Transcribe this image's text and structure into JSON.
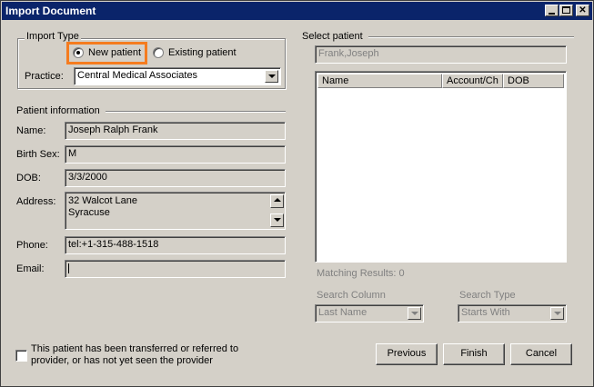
{
  "window": {
    "title": "Import Document"
  },
  "import_type": {
    "group_label": "Import Type",
    "new_patient_label": "New patient",
    "existing_patient_label": "Existing patient",
    "selected": "New patient",
    "practice_label": "Practice:",
    "practice_value": "Central Medical Associates"
  },
  "patient_info": {
    "section_label": "Patient information",
    "name_label": "Name:",
    "name_value": "Joseph Ralph Frank",
    "sex_label": "Birth Sex:",
    "sex_value": "M",
    "dob_label": "DOB:",
    "dob_value": "3/3/2000",
    "address_label": "Address:",
    "address_line1": "32 Walcot Lane",
    "address_line2": "Syracuse",
    "phone_label": "Phone:",
    "phone_value": "tel:+1-315-488-1518",
    "email_label": "Email:",
    "email_value": ""
  },
  "select_patient": {
    "section_label": "Select patient",
    "search_value": "Frank,Joseph",
    "columns": [
      "Name",
      "Account/Ch",
      "DOB"
    ],
    "rows": [],
    "matching_results": "Matching Results: 0",
    "search_column_label": "Search Column",
    "search_column_value": "Last Name",
    "search_type_label": "Search Type",
    "search_type_value": "Starts With"
  },
  "footer": {
    "transfer_line1": "This patient has been transferred or referred to",
    "transfer_line2": "provider, or has not yet seen the provider",
    "previous_label": "Previous",
    "finish_label": "Finish",
    "cancel_label": "Cancel"
  },
  "colors": {
    "titlebar": "#0a246a",
    "dialog_bg": "#d4d0c8",
    "highlight": "#f57c1f"
  }
}
